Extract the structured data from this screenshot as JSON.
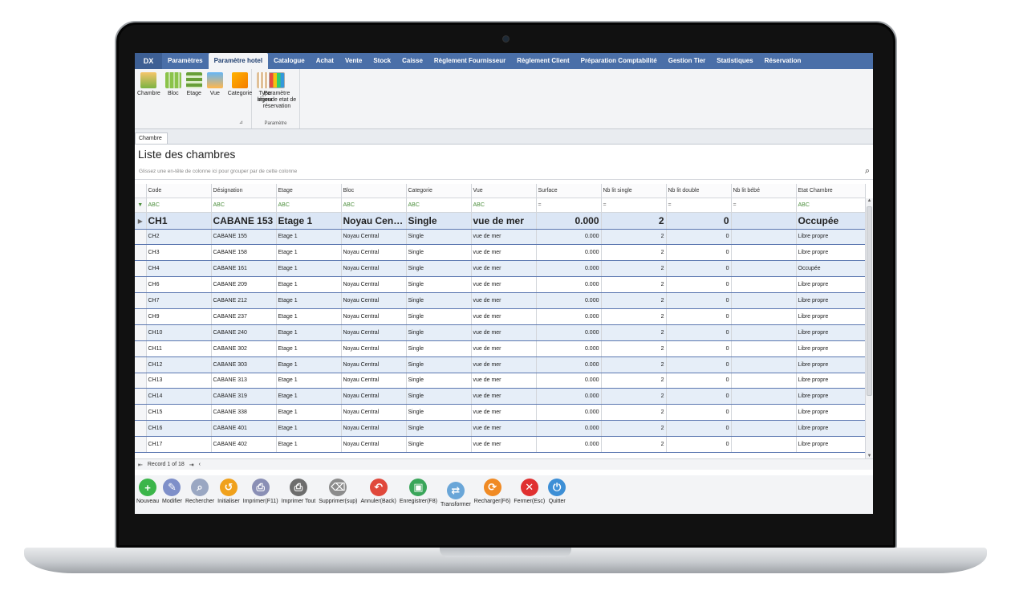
{
  "menu": {
    "logo": "DX",
    "items": [
      "Paramètres",
      "Paramètre hotel",
      "Catalogue",
      "Achat",
      "Vente",
      "Stock",
      "Caisse",
      "Règlement Fournisseur",
      "Règlement Client",
      "Préparation Comptabilité",
      "Gestion Tier",
      "Statistiques",
      "Réservation"
    ],
    "active_index": 1
  },
  "ribbon": {
    "buttons": [
      "Chambre",
      "Bloc",
      "Etage",
      "Vue",
      "Categorie",
      "Type séjour"
    ],
    "legend_button": "Paramètre légende etat de réservation",
    "group_label": "Paramètre"
  },
  "tab": {
    "label": "Chambre"
  },
  "list_title": "Liste des chambres",
  "group_panel_hint": "Glissez une en-tête de colonne ici pour grouper par de cette colonne",
  "columns": [
    "Code",
    "Désignation",
    "Etage",
    "Bloc",
    "Categorie",
    "Vue",
    "Surface",
    "Nb lit single",
    "Nb lit double",
    "Nb lit bébé",
    "Etat Chambre"
  ],
  "filter_row": [
    "ABC",
    "ABC",
    "ABC",
    "ABC",
    "ABC",
    "ABC",
    "=",
    "=",
    "=",
    "=",
    "ABC"
  ],
  "rows": [
    [
      "CH1",
      "CABANE 153",
      "Etage 1",
      "Noyau Central",
      "Single",
      "vue de mer",
      "0.000",
      "2",
      "0",
      "",
      "Occupée"
    ],
    [
      "CH2",
      "CABANE 155",
      "Etage 1",
      "Noyau Central",
      "Single",
      "vue de mer",
      "0.000",
      "2",
      "0",
      "",
      "Libre propre"
    ],
    [
      "CH3",
      "CABANE 158",
      "Etage 1",
      "Noyau Central",
      "Single",
      "vue de mer",
      "0.000",
      "2",
      "0",
      "",
      "Libre propre"
    ],
    [
      "CH4",
      "CABANE 161",
      "Etage 1",
      "Noyau Central",
      "Single",
      "vue de mer",
      "0.000",
      "2",
      "0",
      "",
      "Occupée"
    ],
    [
      "CH6",
      "CABANE 209",
      "Etage 1",
      "Noyau Central",
      "Single",
      "vue de mer",
      "0.000",
      "2",
      "0",
      "",
      "Libre propre"
    ],
    [
      "CH7",
      "CABANE 212",
      "Etage 1",
      "Noyau Central",
      "Single",
      "vue de mer",
      "0.000",
      "2",
      "0",
      "",
      "Libre propre"
    ],
    [
      "CH9",
      "CABANE 237",
      "Etage 1",
      "Noyau Central",
      "Single",
      "vue de mer",
      "0.000",
      "2",
      "0",
      "",
      "Libre propre"
    ],
    [
      "CH10",
      "CABANE 240",
      "Etage 1",
      "Noyau Central",
      "Single",
      "vue de mer",
      "0.000",
      "2",
      "0",
      "",
      "Libre propre"
    ],
    [
      "CH11",
      "CABANE 302",
      "Etage 1",
      "Noyau Central",
      "Single",
      "vue de mer",
      "0.000",
      "2",
      "0",
      "",
      "Libre propre"
    ],
    [
      "CH12",
      "CABANE 303",
      "Etage 1",
      "Noyau Central",
      "Single",
      "vue de mer",
      "0.000",
      "2",
      "0",
      "",
      "Libre propre"
    ],
    [
      "CH13",
      "CABANE 313",
      "Etage 1",
      "Noyau Central",
      "Single",
      "vue de mer",
      "0.000",
      "2",
      "0",
      "",
      "Libre propre"
    ],
    [
      "CH14",
      "CABANE 319",
      "Etage 1",
      "Noyau Central",
      "Single",
      "vue de mer",
      "0.000",
      "2",
      "0",
      "",
      "Libre propre"
    ],
    [
      "CH15",
      "CABANE 338",
      "Etage 1",
      "Noyau Central",
      "Single",
      "vue de mer",
      "0.000",
      "2",
      "0",
      "",
      "Libre propre"
    ],
    [
      "CH16",
      "CABANE 401",
      "Etage 1",
      "Noyau Central",
      "Single",
      "vue de mer",
      "0.000",
      "2",
      "0",
      "",
      "Libre propre"
    ],
    [
      "CH17",
      "CABANE 402",
      "Etage 1",
      "Noyau Central",
      "Single",
      "vue de mer",
      "0.000",
      "2",
      "0",
      "",
      "Libre propre"
    ]
  ],
  "navigator": {
    "record_text": "Record 1 of 18"
  },
  "toolbar": [
    "Nouveau",
    "Modifier",
    "Rechercher",
    "Initialiser",
    "Imprimer(F11)",
    "Imprimer Tout",
    "Supprimer(sup)",
    "Annuler(Back)",
    "Enregistrer(F8)",
    "Transformer",
    "Recharger(F6)",
    "Fermer(Esc)",
    "Quitter"
  ],
  "colors": {
    "menubar": "#4a6fa8",
    "selected_row": "#dbe6f5",
    "row_alt": "#e6eef8",
    "filter_icon": "#4a8d3a"
  }
}
